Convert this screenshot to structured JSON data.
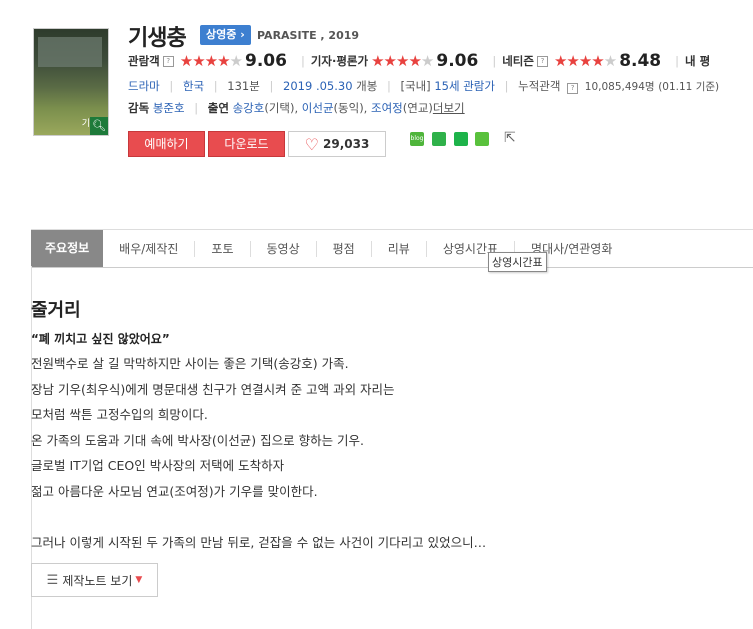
{
  "movie": {
    "title": "기생충",
    "status_badge": "상영중 ›",
    "english_title": "PARASITE , 2019"
  },
  "ratings": {
    "audience_label": "관람객",
    "audience_score": "9.06",
    "critic_label": "기자·평론가",
    "critic_score": "9.06",
    "netizen_label": "네티즌",
    "netizen_score": "8.48",
    "cut_label": "내 평"
  },
  "info": {
    "genre": "드라마",
    "country": "한국",
    "runtime": "131분",
    "release_date": "2019 .05.30",
    "release_suffix": "개봉",
    "rating_prefix": "[국내]",
    "age_rating": "15세 관람가",
    "cumulative_label": "누적관객",
    "cumulative_value": "10,085,494명",
    "cumulative_date": "(01.11 기준)"
  },
  "credits": {
    "director_label": "감독",
    "director": "봉준호",
    "cast_label": "출연",
    "cast1": "송강호",
    "cast1_role": "(기택),",
    "cast2": "이선균",
    "cast2_role": "(동익),",
    "cast3": "조여정",
    "cast3_role": "(연교)",
    "more": "더보기"
  },
  "actions": {
    "reserve": "예매하기",
    "download": "다운로드",
    "like_count": "29,033"
  },
  "poster": {
    "caption": "기"
  },
  "tabs": [
    "주요정보",
    "배우/제작진",
    "포토",
    "동영상",
    "평점",
    "리뷰",
    "상영시간표",
    "명대사/연관영화"
  ],
  "tooltip": "상영시간표",
  "synopsis": {
    "heading": "줄거리",
    "tagline": "“폐 끼치고 싶진 않았어요”",
    "lines": [
      "전원백수로 살 길 막막하지만 사이는 좋은 기택(송강호) 가족.",
      " 장남 기우(최우식)에게 명문대생 친구가 연결시켜 준 고액 과외 자리는",
      " 모처럼 싹튼 고정수입의 희망이다.",
      " 온 가족의 도움과 기대 속에 박사장(이선균) 집으로 향하는 기우.",
      " 글로벌 IT기업 CEO인 박사장의 저택에 도착하자",
      " 젊고 아름다운 사모님 연교(조여정)가 기우를 맞이한다.",
      "",
      " 그러나 이렇게 시작된 두 가족의 만남 뒤로, 걷잡을 수 없는 사건이 기다리고 있었으니…"
    ],
    "notes_button": "제작노트 보기"
  },
  "colors": {
    "accent_red": "#e84c4f",
    "link_blue": "#2b62b5",
    "badge_blue": "#3d7fd0",
    "tab_active": "#888888"
  }
}
